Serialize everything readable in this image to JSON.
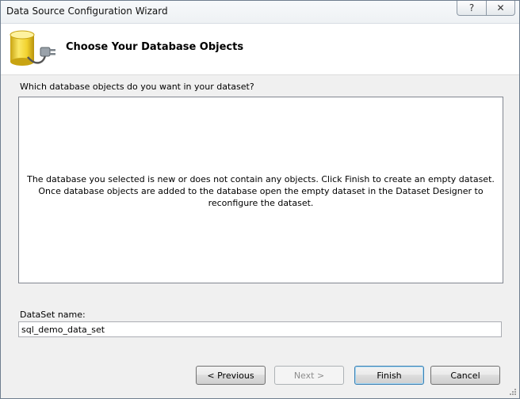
{
  "window": {
    "title": "Data Source Configuration Wizard",
    "help_glyph": "?",
    "close_glyph": "✕"
  },
  "header": {
    "title": "Choose Your Database Objects",
    "icon": "database-plug-icon"
  },
  "main": {
    "question": "Which database objects do you want in your dataset?",
    "message_line1": "The database you selected is new or does not contain any objects. Click Finish to create an empty dataset.",
    "message_line2": "Once database objects are added to the database open the empty dataset in the Dataset Designer to reconfigure the dataset.",
    "dataset_label": "DataSet name:",
    "dataset_value": "sql_demo_data_set"
  },
  "buttons": {
    "previous": "< Previous",
    "next": "Next >",
    "finish": "Finish",
    "cancel": "Cancel"
  },
  "colors": {
    "accent": "#3c7fb1",
    "body_bg": "#f0f0f0",
    "icon_yellow": "#f2d22e"
  }
}
